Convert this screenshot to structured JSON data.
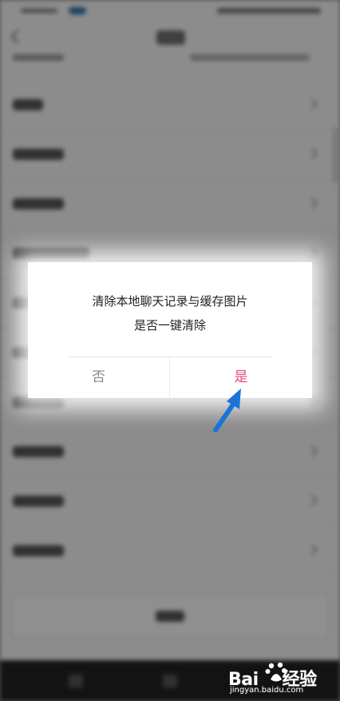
{
  "dialog": {
    "message_line1": "清除本地聊天记录与缓存图片",
    "message_line2": "是否一键清除",
    "cancel_label": "否",
    "confirm_label": "是"
  },
  "colors": {
    "confirm": "#e8457a",
    "cancel": "#8a8a8a",
    "arrow": "#1a73d9"
  },
  "watermark": {
    "brand_left": "Bai",
    "brand_right": "经验",
    "domain": "jingyan.baidu.com"
  }
}
